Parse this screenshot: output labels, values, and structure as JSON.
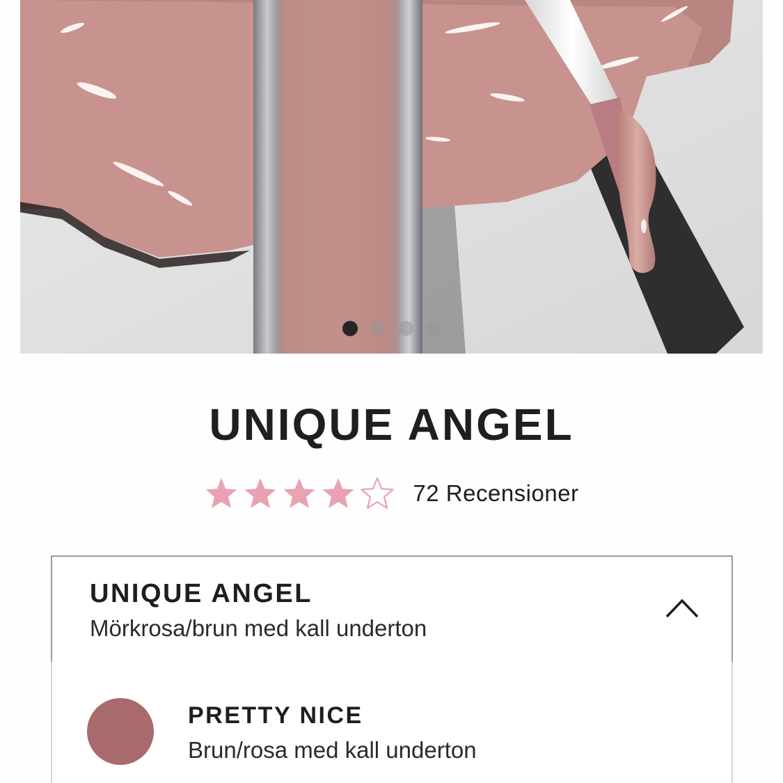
{
  "product": {
    "title": "UNIQUE ANGEL",
    "rating": 4,
    "rating_max": 5,
    "reviews_label": "72 Recensioner"
  },
  "carousel": {
    "total": 4,
    "active": 1
  },
  "shade_selector": {
    "selected_name": "UNIQUE ANGEL",
    "selected_description": "Mörkrosa/brun med kall underton",
    "icon": "chevron-up-icon",
    "options": [
      {
        "name": "PRETTY NICE",
        "description": "Brun/rosa med kall underton",
        "swatch_color": "#a86a6d"
      }
    ]
  },
  "colors": {
    "star_accent": "#e8a2b2",
    "gloss": "#c58f8c"
  }
}
